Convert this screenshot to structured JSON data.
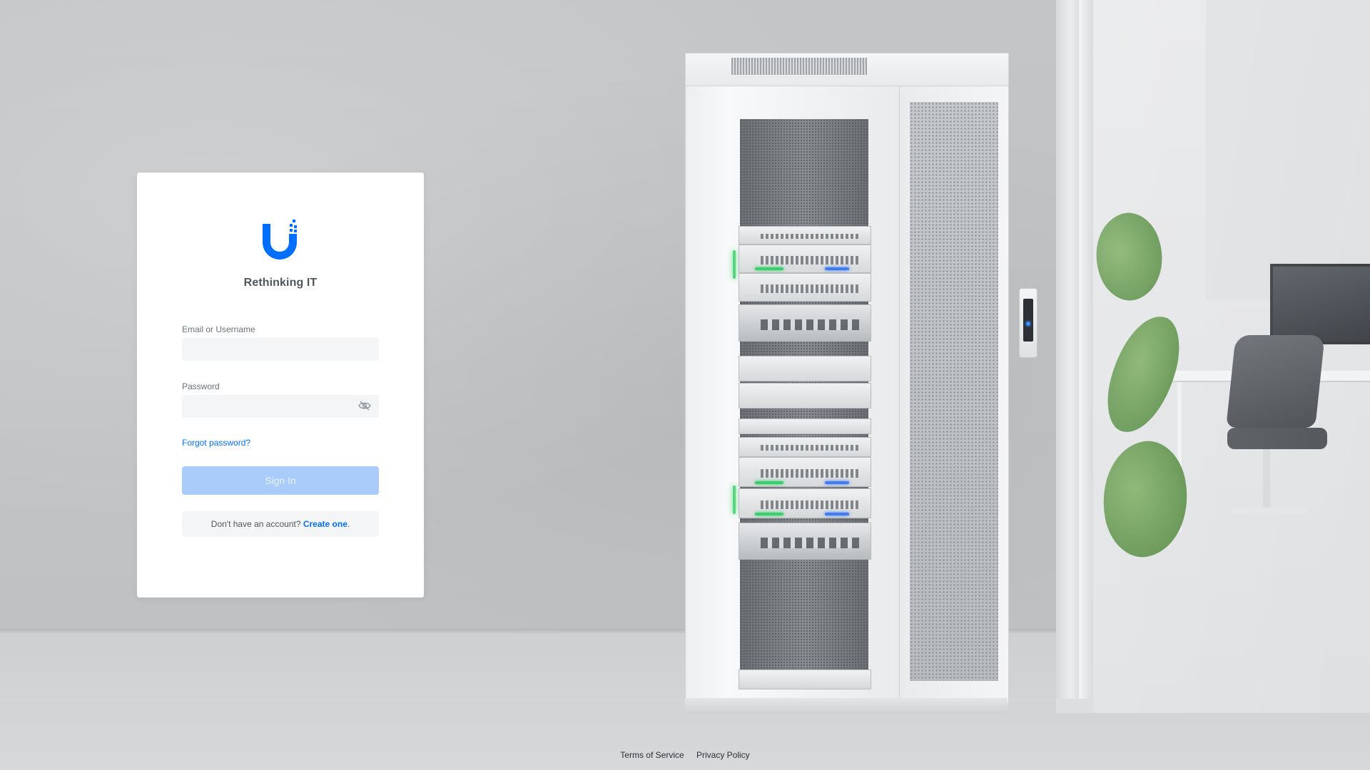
{
  "brand": {
    "tagline": "Rethinking IT",
    "logo_icon": "ubiquiti-u-logo-icon",
    "accent_color": "#006fff"
  },
  "form": {
    "email_label": "Email or Username",
    "email_value": "",
    "password_label": "Password",
    "password_value": "",
    "toggle_visibility_icon": "eye-off-icon",
    "forgot_password": "Forgot password?",
    "sign_in": "Sign In",
    "no_account_text": "Don't have an account?",
    "create_link": "Create one",
    "create_suffix": "."
  },
  "footer": {
    "terms": "Terms of Service",
    "privacy": "Privacy Policy"
  }
}
